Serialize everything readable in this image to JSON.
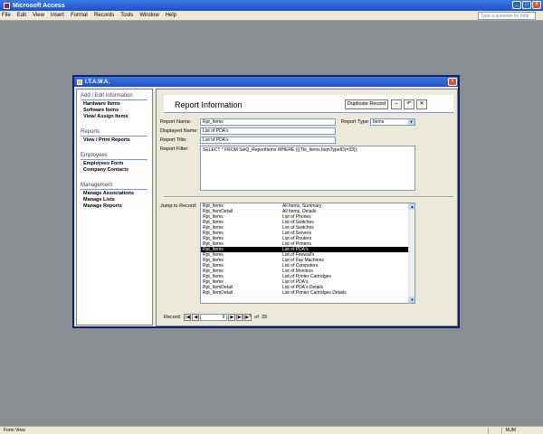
{
  "app": {
    "title": "Microsoft Access"
  },
  "menu": {
    "items": [
      "File",
      "Edit",
      "View",
      "Insert",
      "Format",
      "Records",
      "Tools",
      "Window",
      "Help"
    ]
  },
  "help_box": {
    "placeholder": "Type a question for help"
  },
  "status": {
    "left": "Form View",
    "num": "NUM"
  },
  "form": {
    "title": "I.T.A.W.A.",
    "sidebar": {
      "groups": [
        {
          "heading": "Add / Edit Information",
          "items": [
            "Hardware Items",
            "Software Items",
            "View/ Assign Items"
          ]
        },
        {
          "heading": "Reports",
          "items": [
            "View / Print Reports"
          ]
        },
        {
          "heading": "Employees",
          "items": [
            "Employees Form",
            "Company Contacts"
          ]
        },
        {
          "heading": "Management",
          "items": [
            "Manage Associations",
            "Manage Lists",
            "Manage Reports"
          ]
        }
      ]
    },
    "header": {
      "title": "Report Information",
      "duplicate_label": "Duplicate Record"
    },
    "fields": {
      "report_name_label": "Report Name:",
      "report_name_value": "Rpt_Items",
      "report_type_label": "Report Type:",
      "report_type_value": "Items",
      "displayed_name_label": "Displayed Name:",
      "displayed_name_value": "List of PDA's",
      "report_title_label": "Report Title:",
      "report_title_value": "List of PDA's",
      "report_filter_label": "Report Filter:",
      "report_filter_value": "SELECT * FROM SelQ_ReportItems WHERE (((Tbl_Items.ItemTypeID)=33));"
    },
    "jump": {
      "label": "Jump to Record:",
      "rows": [
        [
          "Rpt_Items",
          "All Items, Summary"
        ],
        [
          "Rpt_ItemDetail",
          "All Items, Details"
        ],
        [
          "Rpt_Items",
          "List of Phones"
        ],
        [
          "Rpt_Items",
          "List of Switches"
        ],
        [
          "Rpt_Items",
          "List of Switches"
        ],
        [
          "Rpt_Items",
          "List of Servers"
        ],
        [
          "Rpt_Items",
          "List of Routers"
        ],
        [
          "Rpt_Items",
          "List of Printers"
        ],
        [
          "Rpt_Items",
          "List of PDA's"
        ],
        [
          "Rpt_Items",
          "List of Firewall's"
        ],
        [
          "Rpt_Items",
          "List of Fax Machines"
        ],
        [
          "Rpt_Items",
          "List of Computers"
        ],
        [
          "Rpt_Items",
          "List of Monitors"
        ],
        [
          "Rpt_Items",
          "List of Printer Cartridges"
        ],
        [
          "Rpt_Items",
          "List of PDA's"
        ],
        [
          "Rpt_ItemDetail",
          "List of PDA's Details"
        ],
        [
          "Rpt_ItemDetail",
          "List of Printer Cartridges Details"
        ]
      ],
      "selected_index": 8
    },
    "nav": {
      "label": "Record:",
      "current": "9",
      "of_label": "of",
      "total": "33"
    }
  }
}
